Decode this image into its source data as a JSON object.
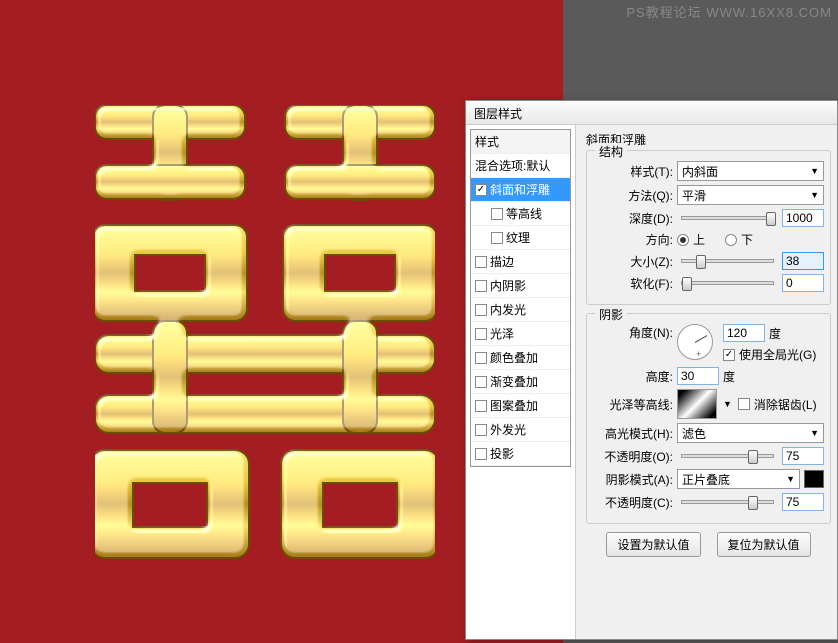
{
  "watermark": "PS教程论坛 WWW.16XX8.COM",
  "dialog": {
    "title": "图层样式",
    "left": {
      "header": "样式",
      "blend": "混合选项:默认",
      "items": [
        {
          "name": "bevel",
          "label": "斜面和浮雕",
          "checked": true,
          "selected": true
        },
        {
          "name": "contour",
          "label": "等高线",
          "checked": false,
          "indent": true
        },
        {
          "name": "texture",
          "label": "纹理",
          "checked": false,
          "indent": true
        },
        {
          "name": "stroke",
          "label": "描边",
          "checked": false
        },
        {
          "name": "inner-shadow",
          "label": "内阴影",
          "checked": false
        },
        {
          "name": "inner-glow",
          "label": "内发光",
          "checked": false
        },
        {
          "name": "satin",
          "label": "光泽",
          "checked": false
        },
        {
          "name": "color-overlay",
          "label": "颜色叠加",
          "checked": false,
          "blue": true
        },
        {
          "name": "gradient-overlay",
          "label": "渐变叠加",
          "checked": false
        },
        {
          "name": "pattern-overlay",
          "label": "图案叠加",
          "checked": false
        },
        {
          "name": "outer-glow",
          "label": "外发光",
          "checked": false
        },
        {
          "name": "drop-shadow",
          "label": "投影",
          "checked": false
        }
      ]
    },
    "right": {
      "title": "斜面和浮雕",
      "structure": {
        "legend": "结构",
        "style_label": "样式(T):",
        "style_value": "内斜面",
        "method_label": "方法(Q):",
        "method_value": "平滑",
        "depth_label": "深度(D):",
        "depth_value": "1000",
        "direction_label": "方向:",
        "up": "上",
        "down": "下",
        "size_label": "大小(Z):",
        "size_value": "38",
        "soften_label": "软化(F):",
        "soften_value": "0"
      },
      "shading": {
        "legend": "阴影",
        "angle_label": "角度(N):",
        "angle_value": "120",
        "angle_unit": "度",
        "global_light": "使用全局光(G)",
        "altitude_label": "高度:",
        "altitude_value": "30",
        "altitude_unit": "度",
        "gloss_label": "光泽等高线:",
        "antialias": "消除锯齿(L)",
        "highlight_mode_label": "高光模式(H):",
        "highlight_mode_value": "滤色",
        "highlight_opacity_label": "不透明度(O):",
        "highlight_opacity_value": "75",
        "shadow_mode_label": "阴影模式(A):",
        "shadow_mode_value": "正片叠底",
        "shadow_opacity_label": "不透明度(C):",
        "shadow_opacity_value": "75"
      },
      "buttons": {
        "default": "设置为默认值",
        "reset": "复位为默认值"
      }
    }
  }
}
